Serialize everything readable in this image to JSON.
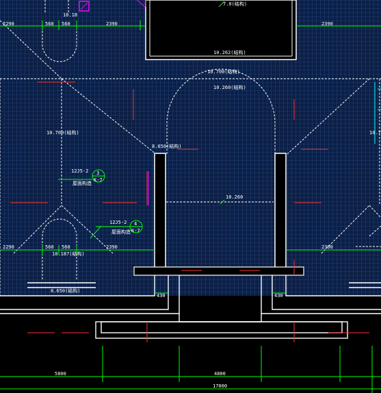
{
  "labels": {
    "top_left_elev": "10.18",
    "dim_left_2290": "2290",
    "dim_left_560_a": "560",
    "dim_left_560_b": "560",
    "dim_left_2390": "2390",
    "dim_right_2390": "2390",
    "top_center_elev": "7.0(结构)",
    "elev_10262": "10.262(结构)",
    "elev_10700": "10.700(结构)",
    "elev_10260": "10.260(结构)",
    "elev_10700_left": "10.700(结构)",
    "elev_10700_right": "10.70",
    "elev_8650": "8.650(结构)",
    "detail_1_ref": "12J5-2",
    "detail_1_num": "3",
    "detail_1_page": "K-7",
    "detail_1_note": "屋面构造",
    "detail_2_ref": "12J5-2",
    "detail_2_num": "4",
    "detail_2_page": "K-7",
    "detail_2_note": "屋面构造",
    "center_elev": "10.260",
    "dim_low_2290": "2290",
    "dim_low_560_a": "560",
    "dim_low_560_b": "560",
    "dim_low_2390_center": "2390",
    "dim_low_2390_right": "2390",
    "elev_low_left": "10.187(结构)",
    "elev_bottom_left": "8.650(结构)",
    "dim_430_left": "430",
    "dim_430_right": "430",
    "dim_5800": "5800",
    "dim_4800": "4800",
    "dim_17000": "17000"
  },
  "colors": {
    "background": "#000000",
    "hatch_grid": "#1f4a8c",
    "hatch_fill": "#0c1f45",
    "lines": "#ffffff",
    "dimension": "#00ff00",
    "axis_red": "#ff3030",
    "magenta": "#ff00ff",
    "cyan": "#00ffff"
  }
}
